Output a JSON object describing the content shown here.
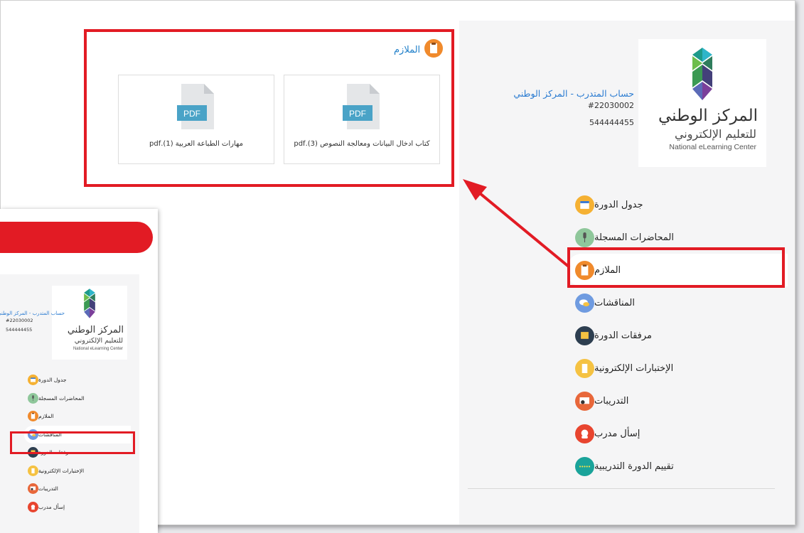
{
  "logo": {
    "arabic_line1": "المركز الوطني",
    "arabic_line2": "للتعليم الإلكتروني",
    "english": "National eLearning Center"
  },
  "account": {
    "name": "حساب المتدرب - المركز الوطني",
    "id": "#22030002",
    "phone": "544444455"
  },
  "menu": [
    {
      "label": "جدول الدورة",
      "icon": "calendar-icon",
      "color": "#f5b133"
    },
    {
      "label": "المحاضرات المسجلة",
      "icon": "microphone-icon",
      "color": "#8fc79b"
    },
    {
      "label": "الملازم",
      "icon": "handout-icon",
      "color": "#f08a2c"
    },
    {
      "label": "المناقشات",
      "icon": "chat-bubbles-icon",
      "color": "#6f9be0"
    },
    {
      "label": "مرفقات الدورة",
      "icon": "attachment-icon",
      "color": "#2d3e50"
    },
    {
      "label": "الإختبارات الإلكترونية",
      "icon": "quiz-icon",
      "color": "#f5c242"
    },
    {
      "label": "التدريبات",
      "icon": "training-icon",
      "color": "#e8673a"
    },
    {
      "label": "إسأل مدرب",
      "icon": "ask-trainer-icon",
      "color": "#e8452f"
    },
    {
      "label": "تقييم الدورة التدريبية",
      "icon": "rating-icon",
      "color": "#1aa39a"
    }
  ],
  "active_menu": "الملازم",
  "section": {
    "title": "الملازم",
    "files": [
      {
        "name": "كتاب ادخال البيانات ومعالجة النصوص (3).pdf",
        "type": "PDF"
      },
      {
        "name": "مهارات الطباعة العربية (1).pdf",
        "type": "PDF"
      }
    ]
  },
  "inset": {
    "active_menu": "المناقشات"
  },
  "colors": {
    "highlight": "#e21b24",
    "link": "#2a7bd1",
    "pdf_badge": "#4aa3c7"
  }
}
